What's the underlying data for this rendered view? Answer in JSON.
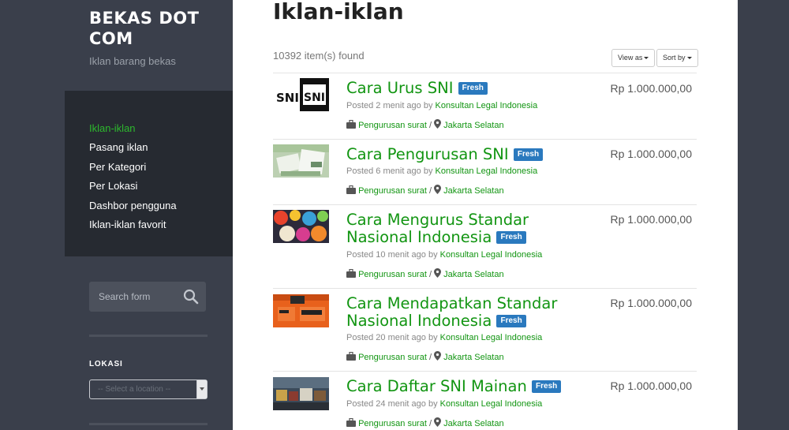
{
  "site": {
    "title": "BEKAS DOT COM",
    "tagline": "Iklan barang bekas"
  },
  "nav": [
    {
      "label": "Iklan-iklan",
      "active": true
    },
    {
      "label": "Pasang iklan"
    },
    {
      "label": "Per Kategori"
    },
    {
      "label": "Per Lokasi"
    },
    {
      "label": "Dashbor pengguna"
    },
    {
      "label": "Iklan-iklan favorit"
    }
  ],
  "search": {
    "placeholder": "Search form"
  },
  "lokasi": {
    "label": "LOKASI",
    "select_value": "-- Select a location --"
  },
  "main": {
    "title": "Iklan-iklan",
    "count": "10392 item(s) found",
    "view_as": "View as",
    "sort_by": "Sort by"
  },
  "listings": [
    {
      "title": "Cara Urus SNI",
      "badge": "Fresh",
      "price": "Rp 1.000.000,00",
      "posted": "Posted 2 menit ago by",
      "author": "Konsultan Legal Indonesia",
      "category": "Pengurusan surat",
      "location": "Jakarta Selatan"
    },
    {
      "title": "Cara Pengurusan SNI",
      "badge": "Fresh",
      "price": "Rp 1.000.000,00",
      "posted": "Posted 6 menit ago by",
      "author": "Konsultan Legal Indonesia",
      "category": "Pengurusan surat",
      "location": "Jakarta Selatan"
    },
    {
      "title": "Cara Mengurus Standar Nasional Indonesia",
      "badge": "Fresh",
      "price": "Rp 1.000.000,00",
      "posted": "Posted 10 menit ago by",
      "author": "Konsultan Legal Indonesia",
      "category": "Pengurusan surat",
      "location": "Jakarta Selatan"
    },
    {
      "title": "Cara Mendapatkan Standar Nasional Indonesia",
      "badge": "Fresh",
      "price": "Rp 1.000.000,00",
      "posted": "Posted 20 menit ago by",
      "author": "Konsultan Legal Indonesia",
      "category": "Pengurusan surat",
      "location": "Jakarta Selatan"
    },
    {
      "title": "Cara Daftar SNI Mainan",
      "badge": "Fresh",
      "price": "Rp 1.000.000,00",
      "posted": "Posted 24 menit ago by",
      "author": "Konsultan Legal Indonesia",
      "category": "Pengurusan surat",
      "location": "Jakarta Selatan"
    }
  ],
  "thumb_logo": {
    "text": "SNI"
  }
}
